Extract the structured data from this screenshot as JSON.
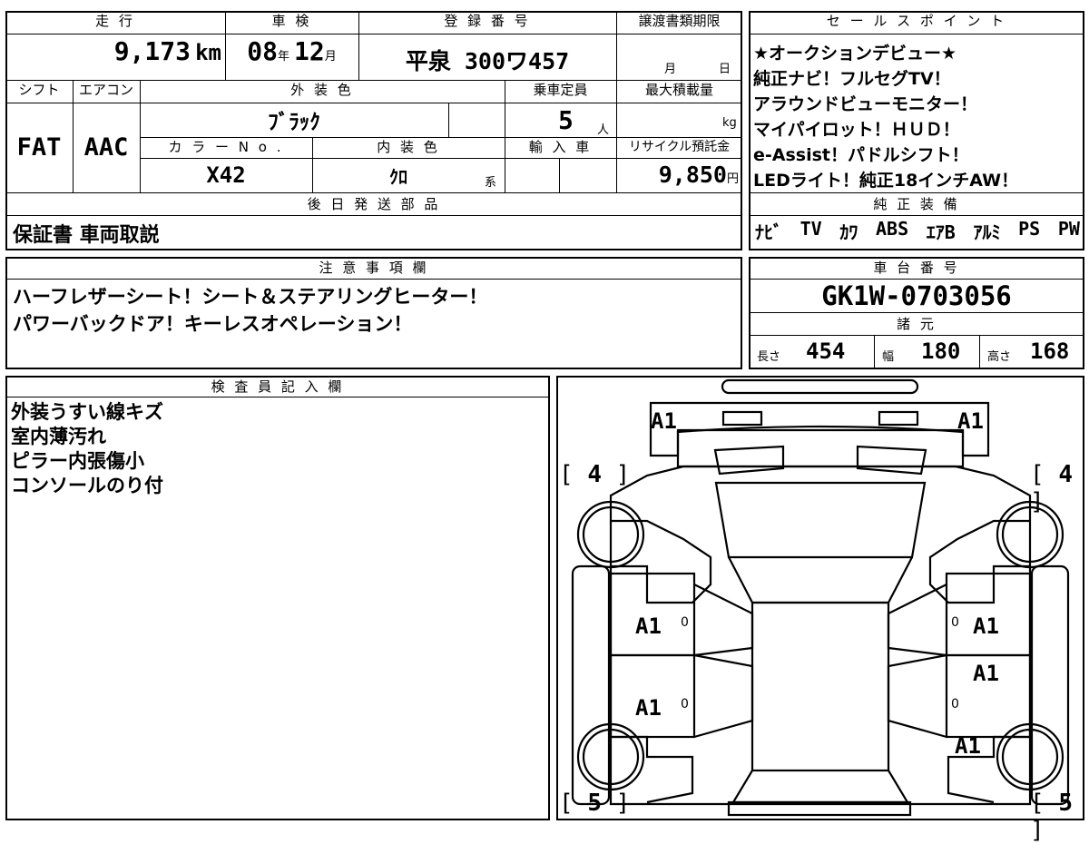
{
  "vehicle": {
    "mileage": {
      "header": "走 行",
      "value": "9,173",
      "unit": "km"
    },
    "inspection": {
      "header": "車 検",
      "year": "08",
      "year_unit": "年",
      "month": "12",
      "month_unit": "月"
    },
    "registration": {
      "header": "登 録 番 号",
      "value": "平泉 300ワ457"
    },
    "transfer_deadline": {
      "header": "譲渡書類期限",
      "month_unit": "月",
      "day_unit": "日"
    },
    "shift": {
      "header": "シフト",
      "value": "FAT"
    },
    "aircon": {
      "header": "エアコン",
      "value": "AAC"
    },
    "exterior_color": {
      "header": "外 装 色",
      "value": "ﾌﾞﾗｯｸ"
    },
    "capacity": {
      "header": "乗車定員",
      "value": "5",
      "unit": "人"
    },
    "max_load": {
      "header": "最大積載量",
      "unit": "kg"
    },
    "color_no": {
      "header": "カ ラ ー N o .",
      "value": "X42"
    },
    "interior_color": {
      "header": "内 装 色",
      "value": "ｸﾛ",
      "unit": "系"
    },
    "import": {
      "header": "輸 入 車"
    },
    "recycle": {
      "header": "リサイクル預託金",
      "value": "9,850",
      "unit": "円"
    }
  },
  "sales_points": {
    "header": "セ ー ル ス ポ イ ン ト",
    "lines": [
      "★オークションデビュー★",
      "純正ナビ！フルセグTV！",
      "アラウンドビューモニター！",
      "マイパイロット！ＨＵＤ！",
      "e-Assist！パドルシフト！",
      "LEDライト！純正18インチAW！"
    ]
  },
  "later_parts": {
    "header": "後 日 発 送 部 品",
    "value": "保証書 車両取説"
  },
  "genuine_equipment": {
    "header": "純 正 装 備",
    "items": [
      "ﾅﾋﾞ",
      "TV",
      "ｶﾜ",
      "ABS",
      "ｴｱB",
      "ｱﾙﾐ",
      "PS",
      "PW"
    ]
  },
  "notes": {
    "header": "注 意 事 項 欄",
    "lines": [
      "ハーフレザーシート！シート＆ステアリングヒーター！",
      "パワーバックドア！キーレスオペレーション！"
    ]
  },
  "chassis": {
    "header": "車 台 番 号",
    "value": "GK1W-0703056"
  },
  "specs": {
    "header": "諸 元",
    "length_label": "長さ",
    "length": "454",
    "width_label": "幅",
    "width": "180",
    "height_label": "高さ",
    "height": "168"
  },
  "inspector": {
    "header": "検 査 員 記 入 欄",
    "lines": [
      "外装うすい線キズ",
      "室内薄汚れ",
      "ピラー内張傷小",
      "コンソールのり付"
    ]
  },
  "diagram": {
    "marks": {
      "front_left": "A1",
      "front_right": "A1",
      "left_front_door": "A1",
      "left_rear_door": "A1",
      "right_front_door": "A1",
      "right_rear_door": "A1",
      "right_rear": "A1"
    },
    "tire_front_left": "4",
    "tire_front_right": "4",
    "tire_rear_left": "5",
    "tire_rear_right": "5",
    "zero": "0"
  }
}
